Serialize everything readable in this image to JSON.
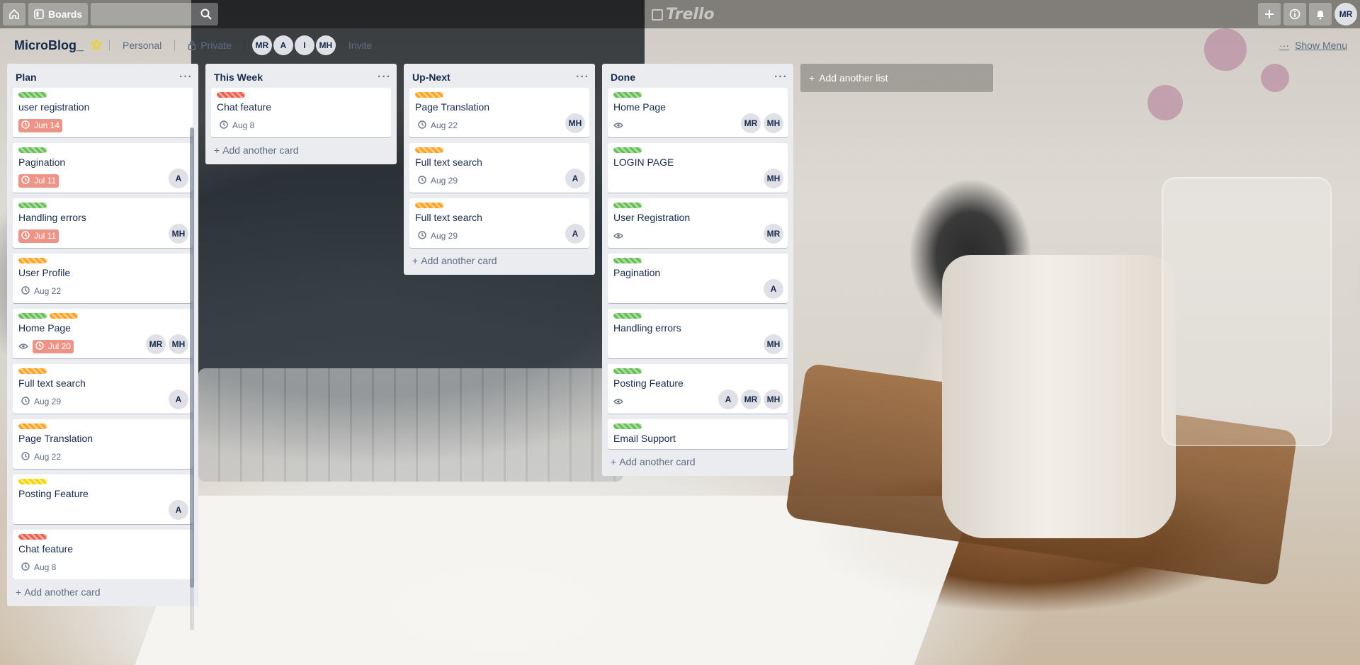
{
  "app": {
    "name": "Trello"
  },
  "header": {
    "boards_label": "Boards",
    "search_placeholder": "",
    "user_initials": "MR"
  },
  "board": {
    "title": "MicroBlog_",
    "team_label": "Personal",
    "visibility_label": "Private",
    "members": [
      "MR",
      "A",
      "I",
      "MH"
    ],
    "invite_label": "Invite",
    "show_menu_label": "Show Menu"
  },
  "colors": {
    "green": "#61bd4f",
    "orange": "#ff9f1a",
    "yellow": "#f2d600",
    "red": "#eb5a46"
  },
  "lists": [
    {
      "title": "Plan",
      "add_card_label": "Add another card",
      "cards": [
        {
          "title": "user registration",
          "labels": [
            "green"
          ],
          "date": "Jun 14",
          "due": true,
          "watch": false,
          "members": []
        },
        {
          "title": "Pagination",
          "labels": [
            "green"
          ],
          "date": "Jul 11",
          "due": true,
          "watch": false,
          "members": [
            "A"
          ]
        },
        {
          "title": "Handling errors",
          "labels": [
            "green"
          ],
          "date": "Jul 11",
          "due": true,
          "watch": false,
          "members": [
            "MH"
          ]
        },
        {
          "title": "User Profile",
          "labels": [
            "orange"
          ],
          "date": "Aug 22",
          "due": false,
          "watch": false,
          "members": []
        },
        {
          "title": "Home Page",
          "labels": [
            "green",
            "orange"
          ],
          "date": "Jul 20",
          "due": true,
          "watch": true,
          "members": [
            "MR",
            "MH"
          ]
        },
        {
          "title": "Full text search",
          "labels": [
            "orange"
          ],
          "date": "Aug 29",
          "due": false,
          "watch": false,
          "members": [
            "A"
          ]
        },
        {
          "title": "Page Translation",
          "labels": [
            "orange"
          ],
          "date": "Aug 22",
          "due": false,
          "watch": false,
          "members": []
        },
        {
          "title": "Posting Feature",
          "labels": [
            "yellow"
          ],
          "date": "",
          "due": false,
          "watch": false,
          "members": [
            "A"
          ]
        },
        {
          "title": "Chat feature",
          "labels": [
            "red"
          ],
          "date": "Aug 8",
          "due": false,
          "watch": false,
          "members": []
        }
      ]
    },
    {
      "title": "This Week",
      "add_card_label": "Add another card",
      "cards": [
        {
          "title": "Chat feature",
          "labels": [
            "red"
          ],
          "date": "Aug 8",
          "due": false,
          "watch": false,
          "members": []
        }
      ]
    },
    {
      "title": "Up-Next",
      "add_card_label": "Add another card",
      "cards": [
        {
          "title": "Page Translation",
          "labels": [
            "orange"
          ],
          "date": "Aug 22",
          "due": false,
          "watch": false,
          "members": [
            "MH"
          ]
        },
        {
          "title": "Full text search",
          "labels": [
            "orange"
          ],
          "date": "Aug 29",
          "due": false,
          "watch": false,
          "members": [
            "A"
          ]
        },
        {
          "title": "Full text search",
          "labels": [
            "orange"
          ],
          "date": "Aug 29",
          "due": false,
          "watch": false,
          "members": [
            "A"
          ]
        }
      ]
    },
    {
      "title": "Done",
      "add_card_label": "Add another card",
      "cards": [
        {
          "title": "Home Page",
          "labels": [
            "green"
          ],
          "date": "",
          "due": false,
          "watch": true,
          "members": [
            "MR",
            "MH"
          ]
        },
        {
          "title": "LOGIN PAGE",
          "labels": [
            "green"
          ],
          "date": "",
          "due": false,
          "watch": false,
          "members": [
            "MH"
          ]
        },
        {
          "title": "User Registration",
          "labels": [
            "green"
          ],
          "date": "",
          "due": false,
          "watch": true,
          "members": [
            "MR"
          ]
        },
        {
          "title": "Pagination",
          "labels": [
            "green"
          ],
          "date": "",
          "due": false,
          "watch": false,
          "members": [
            "A"
          ]
        },
        {
          "title": "Handling errors",
          "labels": [
            "green"
          ],
          "date": "",
          "due": false,
          "watch": false,
          "members": [
            "MH"
          ]
        },
        {
          "title": "Posting Feature",
          "labels": [
            "green"
          ],
          "date": "",
          "due": false,
          "watch": true,
          "members": [
            "A",
            "MR",
            "MH"
          ]
        },
        {
          "title": "Email Support",
          "labels": [
            "green"
          ],
          "date": "",
          "due": false,
          "watch": false,
          "members": []
        }
      ]
    }
  ],
  "add_list_label": "Add another list"
}
